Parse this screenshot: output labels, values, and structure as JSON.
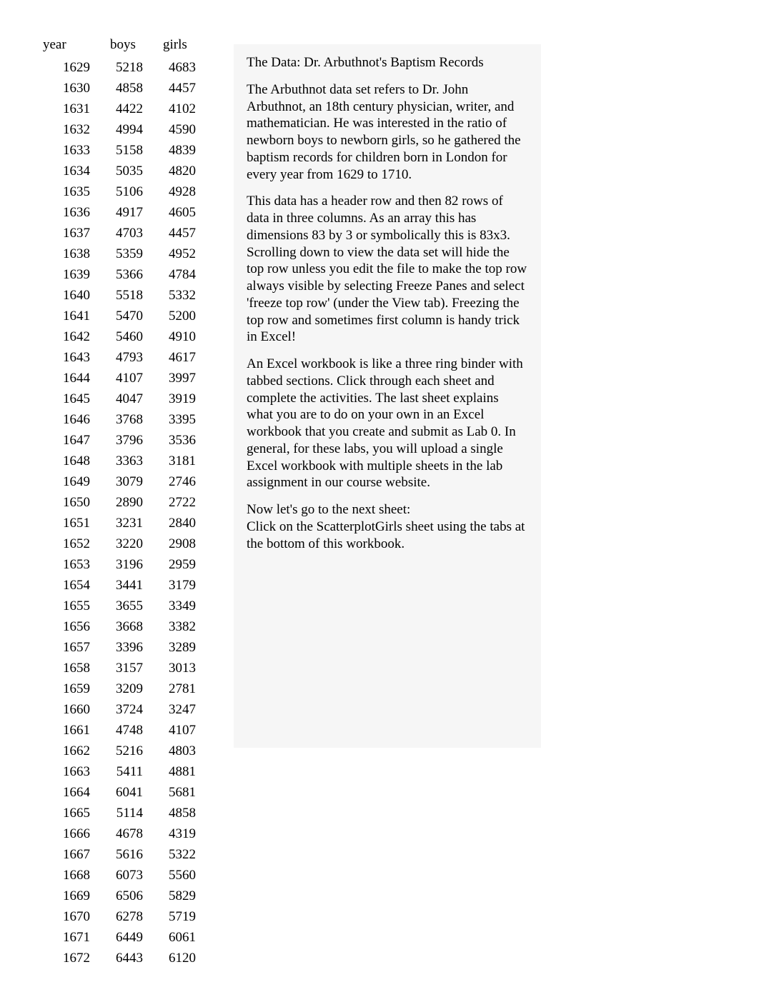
{
  "table": {
    "headers": [
      "year",
      "boys",
      "girls"
    ],
    "rows": [
      [
        1629,
        5218,
        4683
      ],
      [
        1630,
        4858,
        4457
      ],
      [
        1631,
        4422,
        4102
      ],
      [
        1632,
        4994,
        4590
      ],
      [
        1633,
        5158,
        4839
      ],
      [
        1634,
        5035,
        4820
      ],
      [
        1635,
        5106,
        4928
      ],
      [
        1636,
        4917,
        4605
      ],
      [
        1637,
        4703,
        4457
      ],
      [
        1638,
        5359,
        4952
      ],
      [
        1639,
        5366,
        4784
      ],
      [
        1640,
        5518,
        5332
      ],
      [
        1641,
        5470,
        5200
      ],
      [
        1642,
        5460,
        4910
      ],
      [
        1643,
        4793,
        4617
      ],
      [
        1644,
        4107,
        3997
      ],
      [
        1645,
        4047,
        3919
      ],
      [
        1646,
        3768,
        3395
      ],
      [
        1647,
        3796,
        3536
      ],
      [
        1648,
        3363,
        3181
      ],
      [
        1649,
        3079,
        2746
      ],
      [
        1650,
        2890,
        2722
      ],
      [
        1651,
        3231,
        2840
      ],
      [
        1652,
        3220,
        2908
      ],
      [
        1653,
        3196,
        2959
      ],
      [
        1654,
        3441,
        3179
      ],
      [
        1655,
        3655,
        3349
      ],
      [
        1656,
        3668,
        3382
      ],
      [
        1657,
        3396,
        3289
      ],
      [
        1658,
        3157,
        3013
      ],
      [
        1659,
        3209,
        2781
      ],
      [
        1660,
        3724,
        3247
      ],
      [
        1661,
        4748,
        4107
      ],
      [
        1662,
        5216,
        4803
      ],
      [
        1663,
        5411,
        4881
      ],
      [
        1664,
        6041,
        5681
      ],
      [
        1665,
        5114,
        4858
      ],
      [
        1666,
        4678,
        4319
      ],
      [
        1667,
        5616,
        5322
      ],
      [
        1668,
        6073,
        5560
      ],
      [
        1669,
        6506,
        5829
      ],
      [
        1670,
        6278,
        5719
      ],
      [
        1671,
        6449,
        6061
      ],
      [
        1672,
        6443,
        6120
      ]
    ]
  },
  "text": {
    "heading": "The Data: Dr. Arbuthnot's Baptism Records",
    "p1": "The Arbuthnot data set refers to Dr. John Arbuthnot, an 18th century physician, writer, and mathematician. He was interested in the ratio of newborn boys to newborn girls, so he gathered the baptism records for children born in London for every year from 1629 to 1710.",
    "p2": "This data has a header row and then 82 rows of data in three columns. As an array this has dimensions 83 by 3 or symbolically this is 83x3. Scrolling down to view the data set will hide the top row unless you edit the file to make the top row always visible by selecting Freeze Panes and select 'freeze top row' (under the View tab). Freezing the top row and sometimes first column is handy trick in Excel!",
    "p3": "An Excel workbook is like a three ring binder with tabbed sections. Click through each sheet and complete the activities. The last sheet explains what you are to do on your own in an Excel workbook that you create and submit as Lab 0. In general, for these labs, you will upload a single Excel workbook with multiple sheets in the lab assignment in our course website.",
    "p4a": "Now let's go to the next sheet:",
    "p4b": "Click on the ScatterplotGirls sheet using the tabs at the bottom of this workbook."
  }
}
